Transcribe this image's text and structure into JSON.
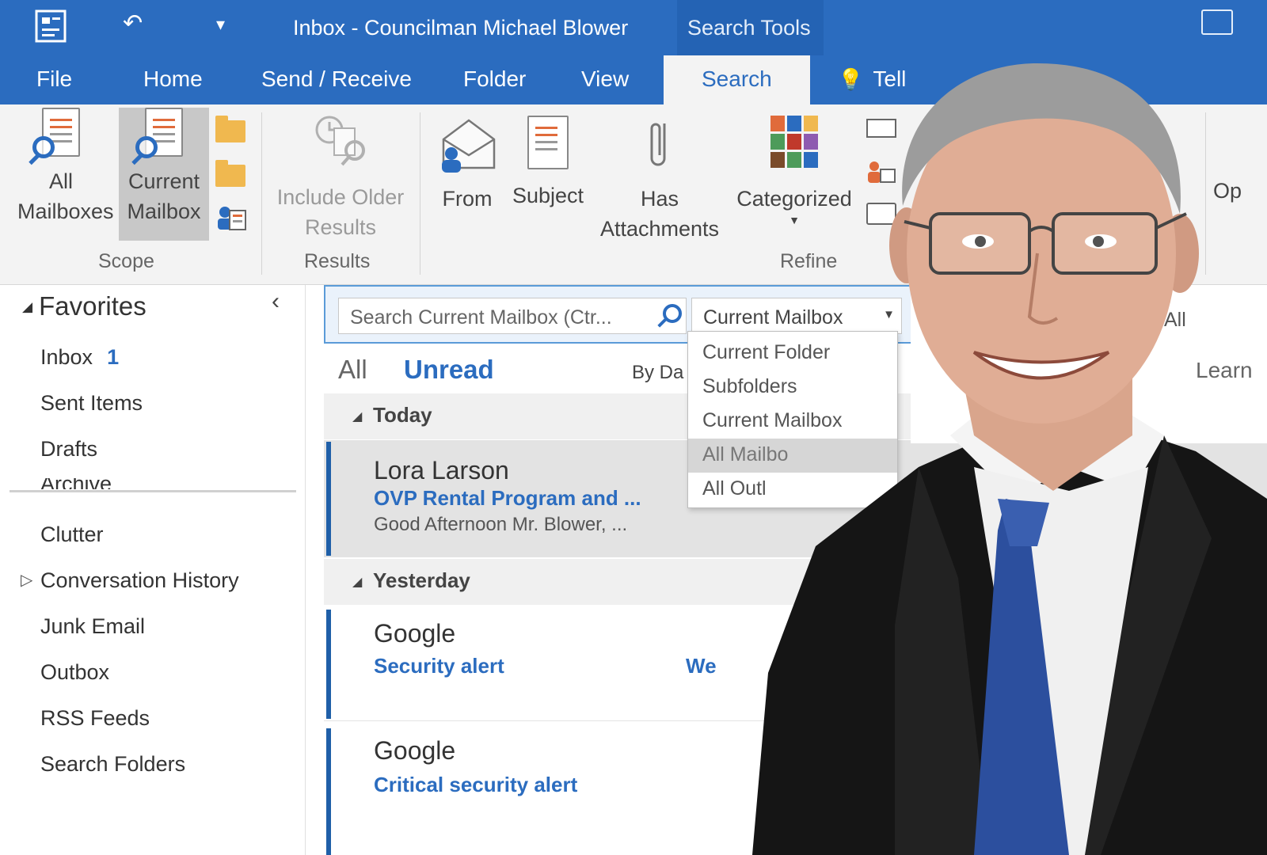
{
  "window": {
    "title": "Inbox - Councilman Michael Blower",
    "context_tab_group": "Search Tools"
  },
  "tabs": [
    {
      "label": "File"
    },
    {
      "label": "Home"
    },
    {
      "label": "Send / Receive"
    },
    {
      "label": "Folder"
    },
    {
      "label": "View"
    },
    {
      "label": "Search",
      "active": true
    },
    {
      "label": "Tell"
    }
  ],
  "ribbon": {
    "scope": {
      "label": "Scope",
      "all_mailboxes": "All Mailboxes",
      "current_mailbox": "Current Mailbox"
    },
    "results": {
      "label": "Results",
      "include_older": "Include Older Results"
    },
    "refine": {
      "label": "Refine",
      "from": "From",
      "subject": "Subject",
      "has_attachments": "Has Attachments",
      "categorized": "Categorized"
    },
    "options_partial": "Op"
  },
  "nav": {
    "favorites": "Favorites",
    "items": [
      {
        "label": "Inbox",
        "count": "1"
      },
      {
        "label": "Sent Items"
      },
      {
        "label": "Drafts"
      },
      {
        "label": "Archive"
      },
      {
        "label": "Clutter"
      },
      {
        "label": "Conversation History"
      },
      {
        "label": "Junk Email"
      },
      {
        "label": "Outbox"
      },
      {
        "label": "RSS Feeds"
      },
      {
        "label": "Search Folders"
      }
    ]
  },
  "search": {
    "placeholder": "Search Current Mailbox (Ctr...",
    "scope_value": "Current Mailbox",
    "scope_options": [
      "Current Folder",
      "Subfolders",
      "Current Mailbox",
      "All Mailbo",
      "All Outl"
    ]
  },
  "list": {
    "filter_all": "All",
    "filter_unread": "Unread",
    "sort": "By Da",
    "groups": {
      "today": "Today",
      "yesterday": "Yesterday"
    },
    "messages": [
      {
        "sender": "Lora Larson",
        "subject": "OVP Rental Program and ...",
        "preview": "Good Afternoon Mr. Blower, ..."
      },
      {
        "sender": "Google",
        "subject": "Security alert",
        "side": "We"
      },
      {
        "sender": "Google",
        "subject": "Critical security alert"
      }
    ]
  },
  "reading_pane": {
    "partial_1": "All",
    "partial_2": "Learn"
  },
  "colors": {
    "accent": "#2b6cbf",
    "ribbon_bg": "#f3f3f3",
    "selected_bg": "#e3e3e3"
  }
}
